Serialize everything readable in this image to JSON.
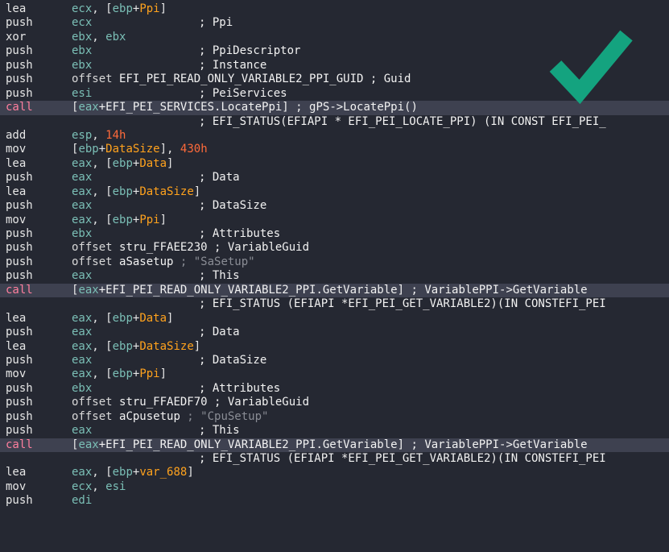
{
  "accent_colors": {
    "mnemonic": "#e6e6e6",
    "call_mnemonic": "#ff7f9e",
    "register": "#7bbfb6",
    "stack_variable": "#ffa21d",
    "number": "#ff6a3a",
    "comment": "#f2f2f2",
    "string_literal": "#8a8d95",
    "checkmark": "#14a37f",
    "background": "#252832"
  },
  "overlay_icon": "checkmark-icon",
  "lines": [
    {
      "mnemonic": "lea",
      "operands": [
        {
          "t": "ecx",
          "c": "reg"
        },
        {
          "t": ", [",
          "c": "punct"
        },
        {
          "t": "ebp",
          "c": "reg"
        },
        {
          "t": "+",
          "c": "punct"
        },
        {
          "t": "Ppi",
          "c": "var"
        },
        {
          "t": "]",
          "c": "punct"
        }
      ],
      "comment": []
    },
    {
      "mnemonic": "push",
      "operands": [
        {
          "t": "ecx",
          "c": "reg"
        }
      ],
      "comment": [
        {
          "t": "; Ppi",
          "c": "com"
        }
      ]
    },
    {
      "mnemonic": "xor",
      "operands": [
        {
          "t": "ebx",
          "c": "reg"
        },
        {
          "t": ", ",
          "c": "punct"
        },
        {
          "t": "ebx",
          "c": "reg"
        }
      ],
      "comment": []
    },
    {
      "mnemonic": "push",
      "operands": [
        {
          "t": "ebx",
          "c": "reg"
        }
      ],
      "comment": [
        {
          "t": "; PpiDescriptor",
          "c": "com"
        }
      ]
    },
    {
      "mnemonic": "push",
      "operands": [
        {
          "t": "ebx",
          "c": "reg"
        }
      ],
      "comment": [
        {
          "t": "; Instance",
          "c": "com"
        }
      ]
    },
    {
      "mnemonic": "push",
      "operands": [
        {
          "t": "offset ",
          "c": "kw"
        },
        {
          "t": "EFI_PEI_READ_ONLY_VARIABLE2_PPI_GUID",
          "c": "sym"
        },
        {
          "t": " ; Guid",
          "c": "com"
        }
      ],
      "comment": []
    },
    {
      "mnemonic": "push",
      "operands": [
        {
          "t": "esi",
          "c": "reg"
        }
      ],
      "comment": [
        {
          "t": "; PeiServices",
          "c": "com"
        }
      ]
    },
    {
      "mnemonic": "call",
      "call": true,
      "operands": [
        {
          "t": "[",
          "c": "punct"
        },
        {
          "t": "eax",
          "c": "reg"
        },
        {
          "t": "+EFI_PEI_SERVICES.LocatePpi]",
          "c": "sym"
        },
        {
          "t": " ; gPS->LocatePpi()",
          "c": "com"
        }
      ],
      "comment": []
    },
    {
      "mnemonic": "",
      "operands": [],
      "comment": [
        {
          "t": "; EFI_STATUS(EFIAPI * EFI_PEI_LOCATE_PPI) (IN CONST EFI_PEI_",
          "c": "com"
        }
      ]
    },
    {
      "mnemonic": "add",
      "operands": [
        {
          "t": "esp",
          "c": "reg"
        },
        {
          "t": ", ",
          "c": "punct"
        },
        {
          "t": "14h",
          "c": "num"
        }
      ],
      "comment": []
    },
    {
      "mnemonic": "mov",
      "operands": [
        {
          "t": "[",
          "c": "punct"
        },
        {
          "t": "ebp",
          "c": "reg"
        },
        {
          "t": "+",
          "c": "punct"
        },
        {
          "t": "DataSize",
          "c": "var"
        },
        {
          "t": "], ",
          "c": "punct"
        },
        {
          "t": "430h",
          "c": "num"
        }
      ],
      "comment": []
    },
    {
      "mnemonic": "lea",
      "operands": [
        {
          "t": "eax",
          "c": "reg"
        },
        {
          "t": ", [",
          "c": "punct"
        },
        {
          "t": "ebp",
          "c": "reg"
        },
        {
          "t": "+",
          "c": "punct"
        },
        {
          "t": "Data",
          "c": "var"
        },
        {
          "t": "]",
          "c": "punct"
        }
      ],
      "comment": []
    },
    {
      "mnemonic": "push",
      "operands": [
        {
          "t": "eax",
          "c": "reg"
        }
      ],
      "comment": [
        {
          "t": "; Data",
          "c": "com"
        }
      ]
    },
    {
      "mnemonic": "lea",
      "operands": [
        {
          "t": "eax",
          "c": "reg"
        },
        {
          "t": ", [",
          "c": "punct"
        },
        {
          "t": "ebp",
          "c": "reg"
        },
        {
          "t": "+",
          "c": "punct"
        },
        {
          "t": "DataSize",
          "c": "var"
        },
        {
          "t": "]",
          "c": "punct"
        }
      ],
      "comment": []
    },
    {
      "mnemonic": "push",
      "operands": [
        {
          "t": "eax",
          "c": "reg"
        }
      ],
      "comment": [
        {
          "t": "; DataSize",
          "c": "com"
        }
      ]
    },
    {
      "mnemonic": "mov",
      "operands": [
        {
          "t": "eax",
          "c": "reg"
        },
        {
          "t": ", [",
          "c": "punct"
        },
        {
          "t": "ebp",
          "c": "reg"
        },
        {
          "t": "+",
          "c": "punct"
        },
        {
          "t": "Ppi",
          "c": "var"
        },
        {
          "t": "]",
          "c": "punct"
        }
      ],
      "comment": []
    },
    {
      "mnemonic": "push",
      "operands": [
        {
          "t": "ebx",
          "c": "reg"
        }
      ],
      "comment": [
        {
          "t": "; Attributes",
          "c": "com"
        }
      ]
    },
    {
      "mnemonic": "push",
      "operands": [
        {
          "t": "offset ",
          "c": "kw"
        },
        {
          "t": "stru_FFAEE230",
          "c": "sym"
        },
        {
          "t": " ; VariableGuid",
          "c": "com"
        }
      ],
      "comment": []
    },
    {
      "mnemonic": "push",
      "operands": [
        {
          "t": "offset ",
          "c": "kw"
        },
        {
          "t": "aSasetup",
          "c": "sym"
        },
        {
          "t": " ; \"SaSetup\"",
          "c": "str"
        }
      ],
      "comment": []
    },
    {
      "mnemonic": "push",
      "operands": [
        {
          "t": "eax",
          "c": "reg"
        }
      ],
      "comment": [
        {
          "t": "; This",
          "c": "com"
        }
      ]
    },
    {
      "mnemonic": "call",
      "call": true,
      "operands": [
        {
          "t": "[",
          "c": "punct"
        },
        {
          "t": "eax",
          "c": "reg"
        },
        {
          "t": "+EFI_PEI_READ_ONLY_VARIABLE2_PPI.GetVariable]",
          "c": "sym"
        },
        {
          "t": " ; VariablePPI->GetVariable",
          "c": "com"
        }
      ],
      "comment": []
    },
    {
      "mnemonic": "",
      "operands": [],
      "comment": [
        {
          "t": "; EFI_STATUS (EFIAPI *EFI_PEI_GET_VARIABLE2)(IN CONSTEFI_PEI",
          "c": "com"
        }
      ]
    },
    {
      "mnemonic": "lea",
      "operands": [
        {
          "t": "eax",
          "c": "reg"
        },
        {
          "t": ", [",
          "c": "punct"
        },
        {
          "t": "ebp",
          "c": "reg"
        },
        {
          "t": "+",
          "c": "punct"
        },
        {
          "t": "Data",
          "c": "var"
        },
        {
          "t": "]",
          "c": "punct"
        }
      ],
      "comment": []
    },
    {
      "mnemonic": "push",
      "operands": [
        {
          "t": "eax",
          "c": "reg"
        }
      ],
      "comment": [
        {
          "t": "; Data",
          "c": "com"
        }
      ]
    },
    {
      "mnemonic": "lea",
      "operands": [
        {
          "t": "eax",
          "c": "reg"
        },
        {
          "t": ", [",
          "c": "punct"
        },
        {
          "t": "ebp",
          "c": "reg"
        },
        {
          "t": "+",
          "c": "punct"
        },
        {
          "t": "DataSize",
          "c": "var"
        },
        {
          "t": "]",
          "c": "punct"
        }
      ],
      "comment": []
    },
    {
      "mnemonic": "push",
      "operands": [
        {
          "t": "eax",
          "c": "reg"
        }
      ],
      "comment": [
        {
          "t": "; DataSize",
          "c": "com"
        }
      ]
    },
    {
      "mnemonic": "mov",
      "operands": [
        {
          "t": "eax",
          "c": "reg"
        },
        {
          "t": ", [",
          "c": "punct"
        },
        {
          "t": "ebp",
          "c": "reg"
        },
        {
          "t": "+",
          "c": "punct"
        },
        {
          "t": "Ppi",
          "c": "var"
        },
        {
          "t": "]",
          "c": "punct"
        }
      ],
      "comment": []
    },
    {
      "mnemonic": "push",
      "operands": [
        {
          "t": "ebx",
          "c": "reg"
        }
      ],
      "comment": [
        {
          "t": "; Attributes",
          "c": "com"
        }
      ]
    },
    {
      "mnemonic": "push",
      "operands": [
        {
          "t": "offset ",
          "c": "kw"
        },
        {
          "t": "stru_FFAEDF70",
          "c": "sym"
        },
        {
          "t": " ; VariableGuid",
          "c": "com"
        }
      ],
      "comment": []
    },
    {
      "mnemonic": "push",
      "operands": [
        {
          "t": "offset ",
          "c": "kw"
        },
        {
          "t": "aCpusetup",
          "c": "sym"
        },
        {
          "t": " ; \"CpuSetup\"",
          "c": "str"
        }
      ],
      "comment": []
    },
    {
      "mnemonic": "push",
      "operands": [
        {
          "t": "eax",
          "c": "reg"
        }
      ],
      "comment": [
        {
          "t": "; This",
          "c": "com"
        }
      ]
    },
    {
      "mnemonic": "call",
      "call": true,
      "operands": [
        {
          "t": "[",
          "c": "punct"
        },
        {
          "t": "eax",
          "c": "reg"
        },
        {
          "t": "+EFI_PEI_READ_ONLY_VARIABLE2_PPI.GetVariable]",
          "c": "sym"
        },
        {
          "t": " ; VariablePPI->GetVariable",
          "c": "com"
        }
      ],
      "comment": []
    },
    {
      "mnemonic": "",
      "operands": [],
      "comment": [
        {
          "t": "; EFI_STATUS (EFIAPI *EFI_PEI_GET_VARIABLE2)(IN CONSTEFI_PEI",
          "c": "com"
        }
      ]
    },
    {
      "mnemonic": "lea",
      "operands": [
        {
          "t": "eax",
          "c": "reg"
        },
        {
          "t": ", [",
          "c": "punct"
        },
        {
          "t": "ebp",
          "c": "reg"
        },
        {
          "t": "+",
          "c": "punct"
        },
        {
          "t": "var_688",
          "c": "var"
        },
        {
          "t": "]",
          "c": "punct"
        }
      ],
      "comment": []
    },
    {
      "mnemonic": "mov",
      "operands": [
        {
          "t": "ecx",
          "c": "reg"
        },
        {
          "t": ", ",
          "c": "punct"
        },
        {
          "t": "esi",
          "c": "reg"
        }
      ],
      "comment": []
    },
    {
      "mnemonic": "push",
      "operands": [
        {
          "t": "edi",
          "c": "reg"
        }
      ],
      "comment": []
    }
  ]
}
